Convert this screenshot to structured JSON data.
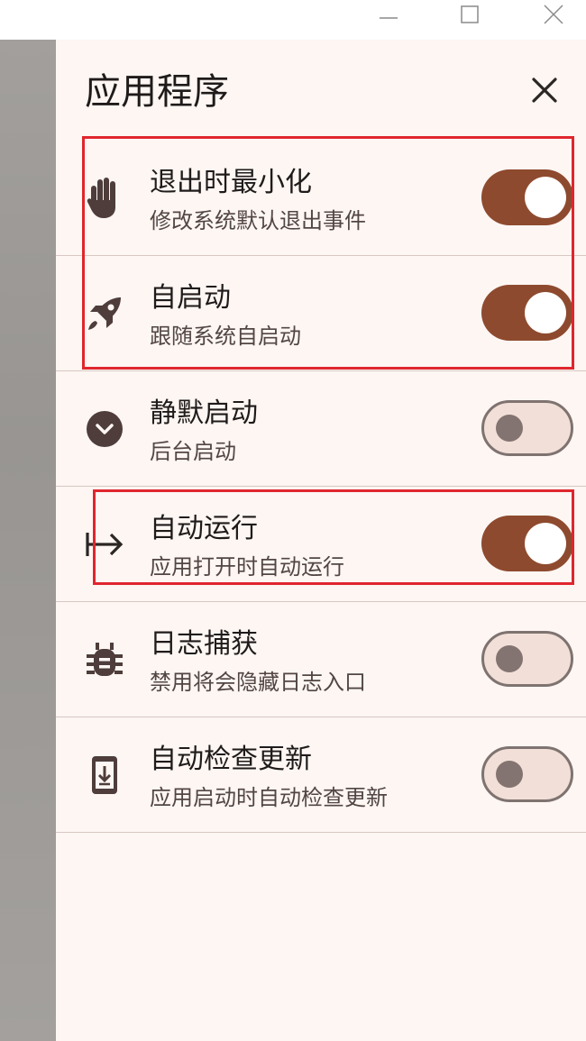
{
  "window_controls": {
    "minimize_icon": "minimize-icon",
    "maximize_icon": "maximize-icon",
    "close_icon": "close-icon"
  },
  "panel": {
    "title": "应用程序",
    "close_icon": "close-icon"
  },
  "items": [
    {
      "icon": "hand-icon",
      "title": "退出时最小化",
      "subtitle": "修改系统默认退出事件",
      "enabled": true
    },
    {
      "icon": "rocket-icon",
      "title": "自启动",
      "subtitle": "跟随系统自启动",
      "enabled": true
    },
    {
      "icon": "chevron-down-circle-icon",
      "title": "静默启动",
      "subtitle": "后台启动",
      "enabled": false
    },
    {
      "icon": "arrow-right-to-line-icon",
      "title": "自动运行",
      "subtitle": "应用打开时自动运行",
      "enabled": true
    },
    {
      "icon": "bug-icon",
      "title": "日志捕获",
      "subtitle": "禁用将会隐藏日志入口",
      "enabled": false
    },
    {
      "icon": "phone-download-icon",
      "title": "自动检查更新",
      "subtitle": "应用启动时自动检查更新",
      "enabled": false
    }
  ],
  "colors": {
    "switch_on": "#8e4a2e",
    "switch_off_track": "#f1dfd8",
    "panel_background": "#fdf6f3",
    "highlight": "#e0262e"
  }
}
